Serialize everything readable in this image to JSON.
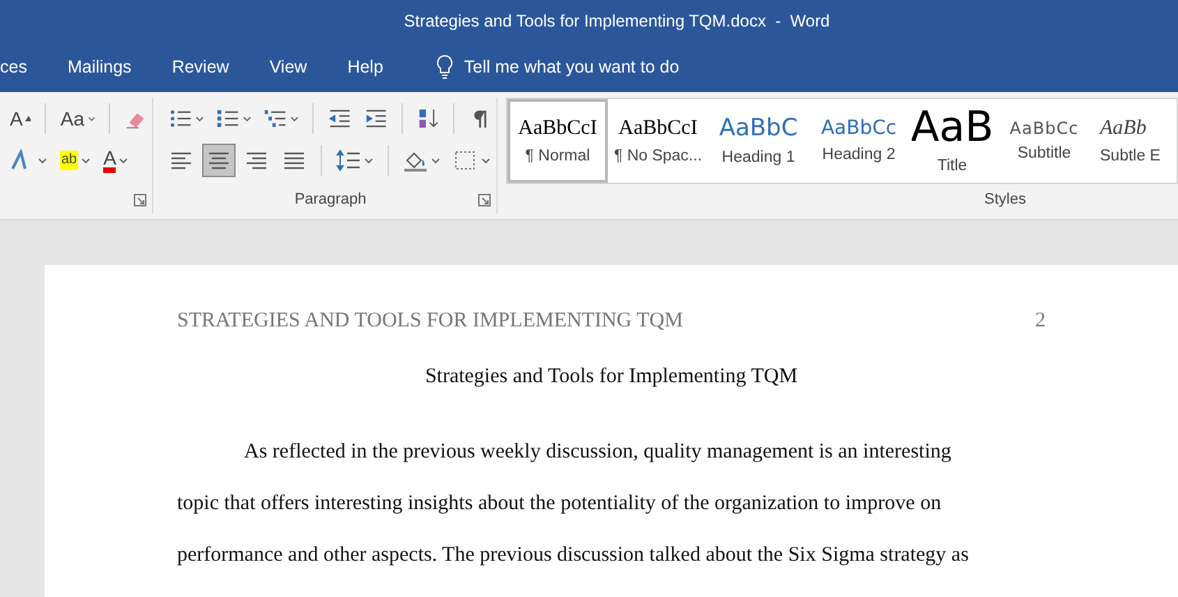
{
  "window": {
    "title": "Strategies and Tools for Implementing TQM.docx  -  Word"
  },
  "ribbon_tabs": [
    {
      "label": "ces"
    },
    {
      "label": "Mailings"
    },
    {
      "label": "Review"
    },
    {
      "label": "View"
    },
    {
      "label": "Help"
    }
  ],
  "tell_me": {
    "label": "Tell me what you want to do"
  },
  "font_group": {
    "row1": [
      {
        "kind": "grow_font",
        "label": "A",
        "dropdown": false
      },
      {
        "kind": "separator"
      },
      {
        "kind": "change_case",
        "label": "Aa",
        "dropdown": true
      },
      {
        "kind": "separator"
      },
      {
        "kind": "clear_format",
        "dropdown": false
      }
    ],
    "row2": [
      {
        "kind": "text_effects",
        "dropdown": true
      },
      {
        "kind": "highlight",
        "label": "ab",
        "dropdown": true
      },
      {
        "kind": "font_color",
        "label": "A",
        "dropdown": true
      }
    ]
  },
  "paragraph_group": {
    "label": "Paragraph",
    "row1": [
      {
        "kind": "bullets",
        "dropdown": true
      },
      {
        "kind": "numbering",
        "dropdown": true
      },
      {
        "kind": "multilevel",
        "dropdown": true
      },
      {
        "kind": "separator"
      },
      {
        "kind": "decrease_indent",
        "dropdown": false
      },
      {
        "kind": "increase_indent",
        "dropdown": false
      },
      {
        "kind": "separator"
      },
      {
        "kind": "sort",
        "dropdown": false
      },
      {
        "kind": "separator"
      },
      {
        "kind": "pilcrow",
        "dropdown": false
      }
    ],
    "row2": [
      {
        "kind": "align_left",
        "selected": false,
        "dropdown": false
      },
      {
        "kind": "align_center",
        "selected": true,
        "dropdown": false
      },
      {
        "kind": "align_right",
        "selected": false,
        "dropdown": false
      },
      {
        "kind": "justify",
        "selected": false,
        "dropdown": false
      },
      {
        "kind": "separator"
      },
      {
        "kind": "line_spacing",
        "dropdown": true
      },
      {
        "kind": "separator"
      },
      {
        "kind": "shading",
        "dropdown": true
      },
      {
        "kind": "borders",
        "dropdown": true
      }
    ]
  },
  "styles_group": {
    "label": "Styles",
    "items": [
      {
        "kind": "normal",
        "preview": "AaBbCcI",
        "label": "¶ Normal",
        "selected": true
      },
      {
        "kind": "normal",
        "preview": "AaBbCcI",
        "label": "¶ No Spac...",
        "selected": false
      },
      {
        "kind": "heading1",
        "preview": "AaBbC",
        "label": "Heading 1",
        "selected": false
      },
      {
        "kind": "heading2",
        "preview": "AaBbCc",
        "label": "Heading 2",
        "selected": false
      },
      {
        "kind": "title",
        "preview": "AaB",
        "label": "Title",
        "selected": false
      },
      {
        "kind": "subtitle",
        "preview": "AaBbCc",
        "label": "Subtitle",
        "selected": false
      },
      {
        "kind": "emphasis",
        "preview": "AaBb",
        "label": "Subtle E",
        "selected": false
      }
    ]
  },
  "document": {
    "header_title": "STRATEGIES AND TOOLS FOR IMPLEMENTING TQM",
    "page_number": "2",
    "heading": "Strategies and Tools for Implementing TQM",
    "body_lines": [
      "As reflected in the previous weekly discussion, quality management is an interesting",
      "topic that offers interesting insights about the potentiality of the organization to improve on",
      "performance and other aspects. The previous discussion talked about the Six Sigma strategy as"
    ]
  }
}
